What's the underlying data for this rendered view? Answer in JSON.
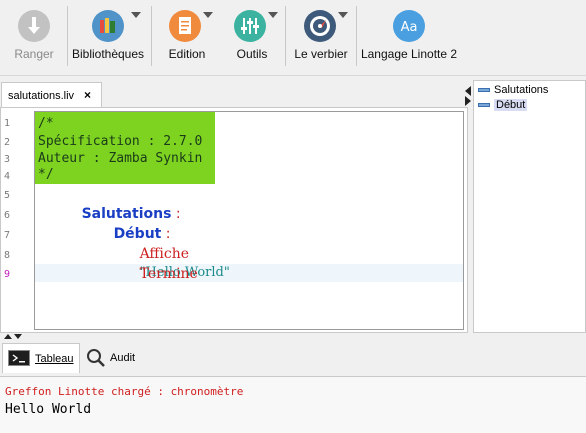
{
  "toolbar": {
    "buttons": [
      {
        "label": "Ranger",
        "icon": "download-icon",
        "color": "#bdbdbd",
        "enabled": false
      },
      {
        "label": "Bibliothèques",
        "icon": "books-icon",
        "color": "#4f93c9"
      },
      {
        "label": "Edition",
        "icon": "document-icon",
        "color": "#f08a3c"
      },
      {
        "label": "Outils",
        "icon": "sliders-icon",
        "color": "#3bb3a0"
      },
      {
        "label": "Le verbier",
        "icon": "compass-icon",
        "color": "#3d5a7a"
      },
      {
        "label": "Langage Linotte 2",
        "icon": "font-aa-icon",
        "color": "#4a9fe0"
      }
    ]
  },
  "editor": {
    "tab_label": "salutations.liv",
    "tab_close": "×",
    "line_numbers": [
      "1",
      "2",
      "3",
      "4",
      "5",
      "6",
      "7",
      "8",
      "9"
    ],
    "lines": {
      "l1": "/*",
      "l2": "Spécification : 2.7.0",
      "l3": "Auteur : Zamba Synkin",
      "l4": "*/",
      "l5_kw": "Salutations",
      "l5_punct": " :",
      "l6_kw": "Début",
      "l6_punct": " :",
      "l7_kw": "Affiche",
      "l7_str": "\"Hello World\"",
      "l8_kw": "Termine"
    },
    "colors": {
      "comment_bg": "#7ed321",
      "keyword": "#1a3fc4",
      "verb": "#cc1f1f",
      "string": "#1a8a8a"
    }
  },
  "outline": {
    "items": [
      "Salutations",
      "Début"
    ],
    "selected": "Début"
  },
  "bottom": {
    "tabs": [
      {
        "label": "Tableau",
        "icon": "terminal-icon"
      },
      {
        "label": "Audit",
        "icon": "magnifier-icon"
      }
    ],
    "console_lines": [
      "Greffon Linotte chargé : chronomètre",
      "Hello World"
    ]
  }
}
